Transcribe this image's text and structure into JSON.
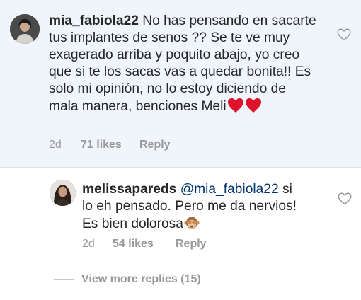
{
  "comment": {
    "username": "mia_fabiola22",
    "text": "No has pensando en sacarte tus implantes de senos ?? Se te ve muy exagerado arriba y poquito abajo, yo creo que si te los sacas vas a quedar bonita!! Es solo mi opinión, no lo estoy diciendo de mala manera, benciones Meli",
    "emoji": [
      "red-heart",
      "red-heart"
    ],
    "time": "2d",
    "likes": "71 likes",
    "reply_label": "Reply"
  },
  "reply": {
    "username": "melissapareds",
    "mention": "@mia_fabiola22",
    "text": " si lo eh pensado. Pero me da nervios! Es bien dolorosa",
    "emoji": [
      "see-no-evil-monkey"
    ],
    "time": "2d",
    "likes": "54 likes",
    "reply_label": "Reply"
  },
  "view_more_replies": "View more replies (15)",
  "colors": {
    "highlight_bg": "#eff5fb",
    "text": "#262626",
    "meta": "#999999",
    "mention": "#003569",
    "heart": "#e0112b"
  }
}
